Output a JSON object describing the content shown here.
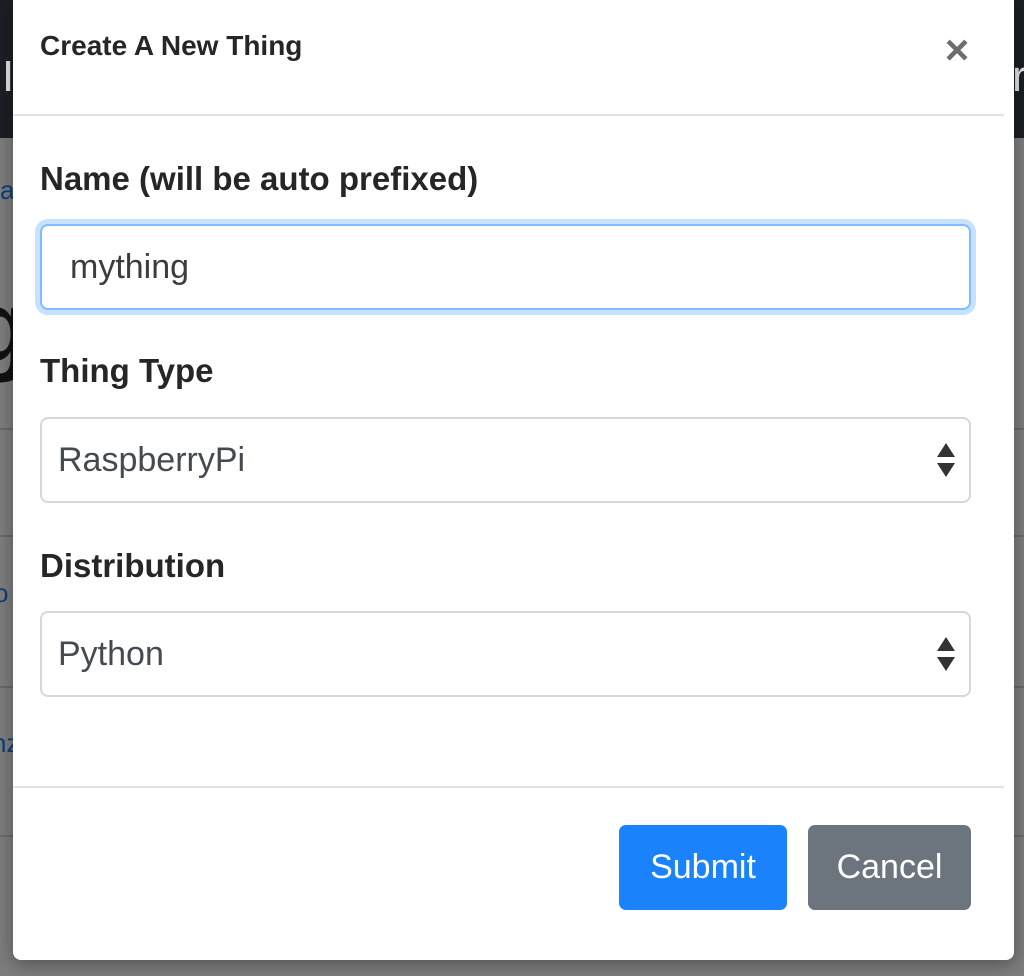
{
  "background": {
    "fragments": [
      "a",
      "g",
      "o",
      "nz",
      "I",
      "r"
    ]
  },
  "modal": {
    "title": "Create A New Thing",
    "close_symbol": "×",
    "name_field": {
      "label": "Name (will be auto prefixed)",
      "value": "mything"
    },
    "thing_type": {
      "label": "Thing Type",
      "selected": "RaspberryPi"
    },
    "distribution": {
      "label": "Distribution",
      "selected": "Python"
    },
    "buttons": {
      "submit": "Submit",
      "cancel": "Cancel"
    }
  },
  "colors": {
    "submit": "#1a82fb",
    "cancel": "#6c757d",
    "focus_border": "#80bdff"
  },
  "icons": {
    "close": "close-icon",
    "select_arrows": "updown-arrows-icon"
  }
}
